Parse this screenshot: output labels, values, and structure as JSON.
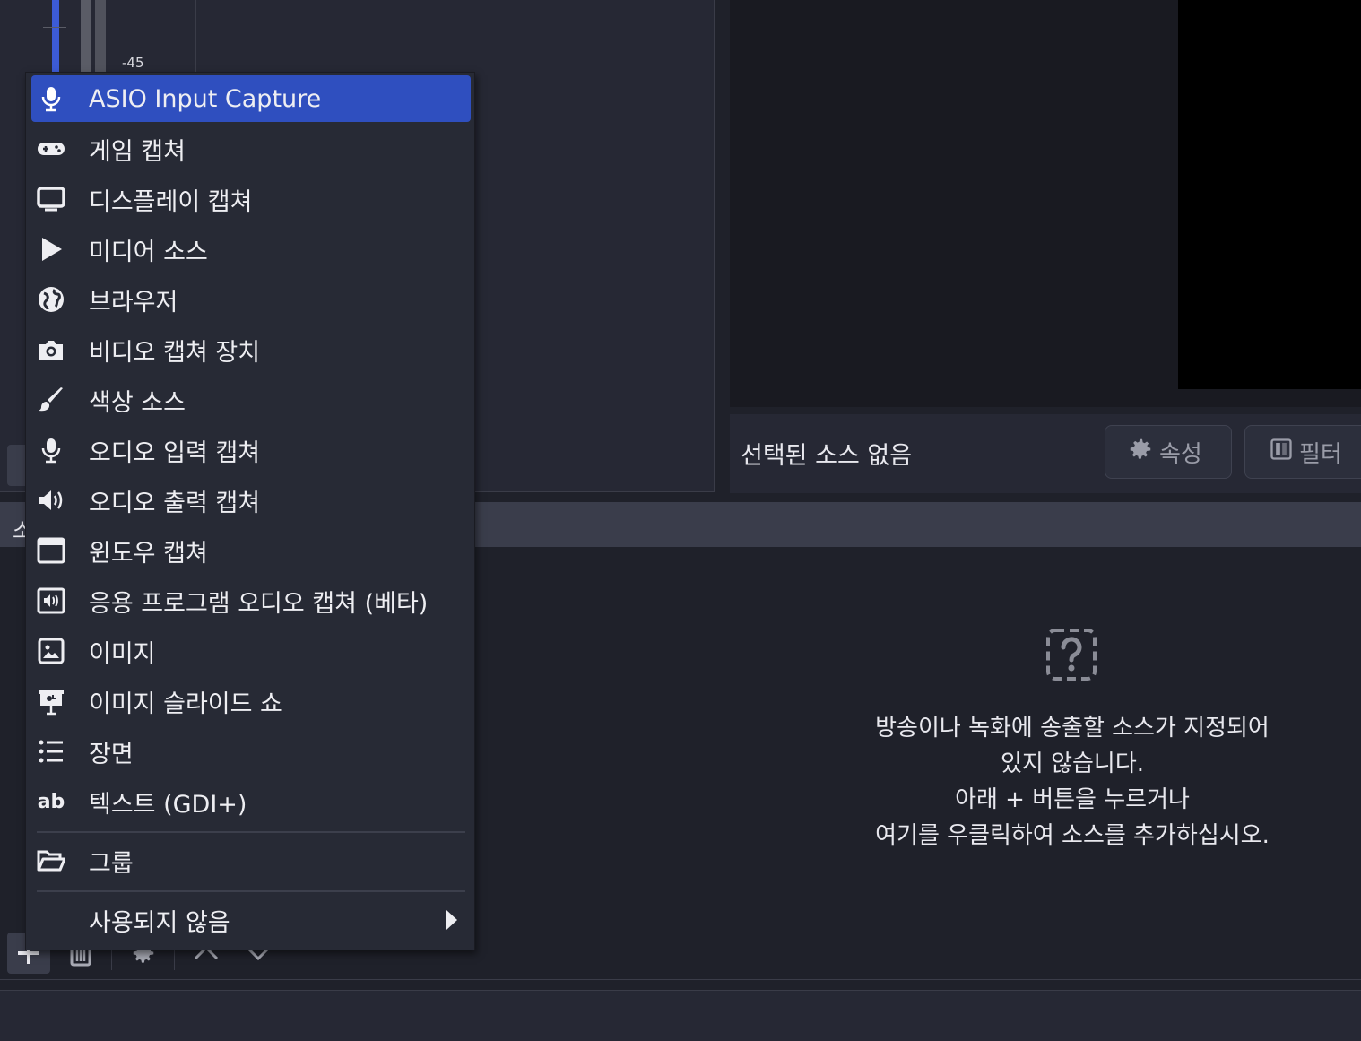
{
  "mixer": {
    "db_label": "-45"
  },
  "context_bar": {
    "no_source_text": "선택된 소스 없음",
    "properties_label": "속성",
    "filters_label": "필터"
  },
  "sources": {
    "header_label": "소",
    "empty_message": [
      "방송이나 녹화에 송출할 소스가 지정되어",
      "있지 않습니다.",
      "아래 + 버튼을 누르거나",
      "여기를 우클릭하여 소스를 추가하십시오."
    ]
  },
  "menu": {
    "items": [
      {
        "label": "ASIO Input Capture",
        "icon": "microphone-icon",
        "active": true
      },
      {
        "label": "게임 캡쳐",
        "icon": "gamepad-icon"
      },
      {
        "label": "디스플레이 캡쳐",
        "icon": "monitor-icon"
      },
      {
        "label": "미디어 소스",
        "icon": "play-icon"
      },
      {
        "label": "브라우저",
        "icon": "globe-icon"
      },
      {
        "label": "비디오 캡쳐 장치",
        "icon": "camera-icon"
      },
      {
        "label": "색상 소스",
        "icon": "brush-icon"
      },
      {
        "label": "오디오 입력 캡쳐",
        "icon": "microphone-icon"
      },
      {
        "label": "오디오 출력 캡쳐",
        "icon": "speaker-icon"
      },
      {
        "label": "윈도우 캡쳐",
        "icon": "window-icon"
      },
      {
        "label": "응용 프로그램 오디오 캡쳐 (베타)",
        "icon": "app-audio-icon"
      },
      {
        "label": "이미지",
        "icon": "image-icon"
      },
      {
        "label": "이미지 슬라이드 쇼",
        "icon": "slideshow-icon"
      },
      {
        "label": "장면",
        "icon": "list-icon"
      },
      {
        "label": "텍스트 (GDI+)",
        "icon": "text-icon"
      }
    ],
    "group_label": "그룹",
    "deprecated_label": "사용되지 않음"
  },
  "colors": {
    "accent": "#2f4fbf",
    "menu_bg": "#272a35",
    "background": "#1f212a"
  }
}
